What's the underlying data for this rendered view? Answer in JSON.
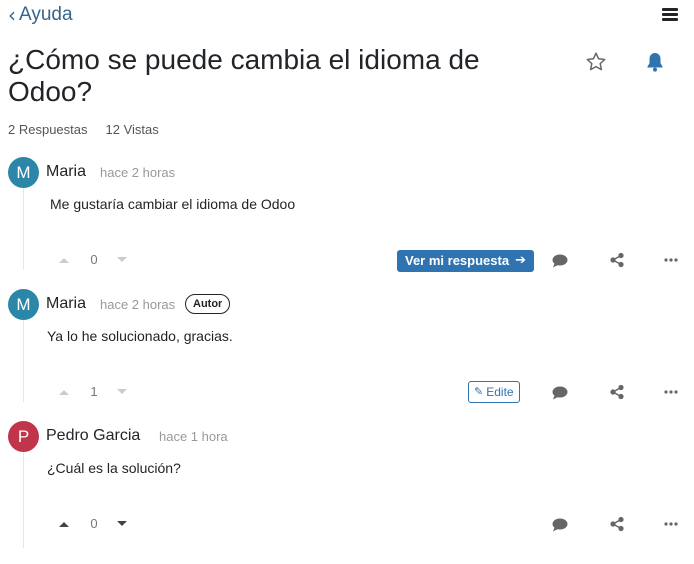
{
  "nav": {
    "back_label": "Ayuda"
  },
  "question": {
    "title": "¿Cómo se puede cambia el idioma de Odoo?",
    "answers_count": "2 Respuestas",
    "views_count": "12 Vistas"
  },
  "posts": [
    {
      "avatar_letter": "M",
      "avatar_color": "#2c86a8",
      "author": "Maria",
      "time": "hace 2 horas",
      "body": "Me gustaría cambiar el idioma de Odoo",
      "votes": "0",
      "action_label": "Ver mi respuesta"
    },
    {
      "avatar_letter": "M",
      "avatar_color": "#2c86a8",
      "author": "Maria",
      "time": "hace 2 horas",
      "badge": "Autor",
      "body": "Ya lo he solucionado, gracias.",
      "votes": "1",
      "action_label": "Edite"
    },
    {
      "avatar_letter": "P",
      "avatar_color": "#c03549",
      "author": "Pedro Garcia",
      "time": "hace 1 hora",
      "body": "¿Cuál es la solución?",
      "votes": "0"
    }
  ],
  "colors": {
    "accent": "#2f73b1",
    "link": "#35658c"
  },
  "icons": [
    "chevron-left-icon",
    "hamburger-menu-icon",
    "star-outline-icon",
    "bell-icon",
    "caret-up-icon",
    "caret-down-icon",
    "comment-icon",
    "share-icon",
    "more-dots-icon",
    "arrow-right-icon",
    "pencil-icon"
  ]
}
